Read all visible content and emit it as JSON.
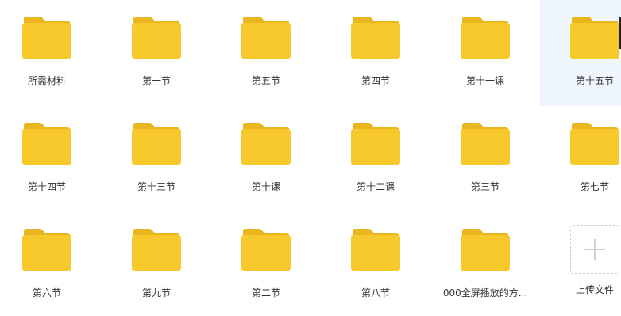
{
  "folders": [
    {
      "name": "所需材料"
    },
    {
      "name": "第一节"
    },
    {
      "name": "第五节"
    },
    {
      "name": "第四节"
    },
    {
      "name": "第十一课"
    },
    {
      "name": "第十五节",
      "selected": true
    },
    {
      "name": "第十四节"
    },
    {
      "name": "第十三节"
    },
    {
      "name": "第十课"
    },
    {
      "name": "第十二课"
    },
    {
      "name": "第三节"
    },
    {
      "name": "第七节"
    },
    {
      "name": "第六节"
    },
    {
      "name": "第九节"
    },
    {
      "name": "第二节"
    },
    {
      "name": "第八节"
    },
    {
      "name": "000全屏播放的方..."
    }
  ],
  "upload": {
    "label": "上传文件",
    "icon": "plus-icon"
  },
  "colors": {
    "folder_back": "#E9B620",
    "folder_front": "#F7C92C",
    "selected_bg": "#EFF6FD",
    "label_text": "#333333"
  }
}
